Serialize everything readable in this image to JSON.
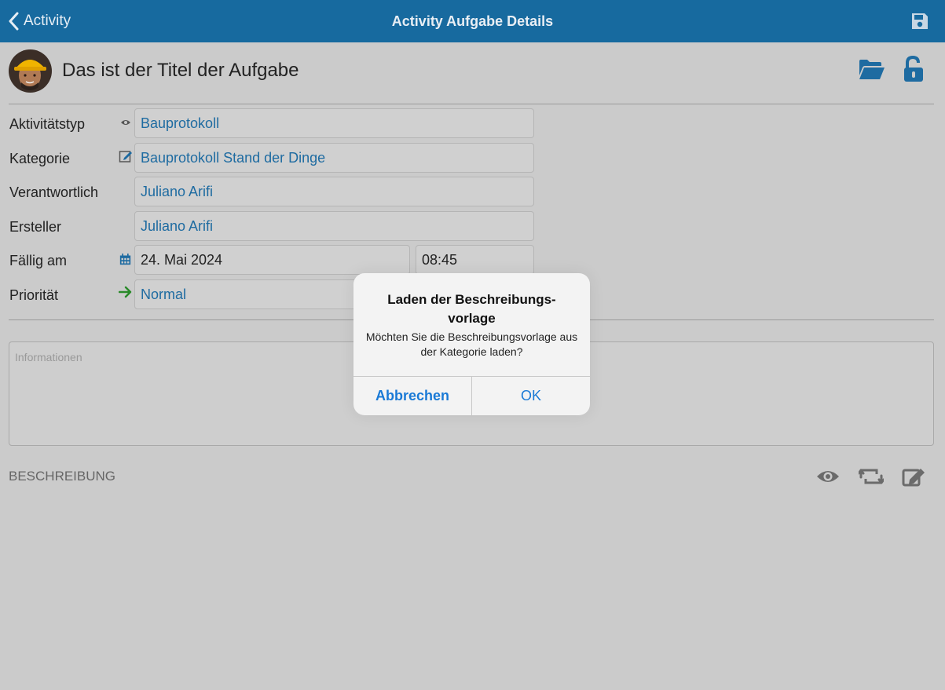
{
  "navbar": {
    "back_label": "Activity",
    "title": "Activity Aufgabe Details",
    "save_icon": "save-icon"
  },
  "header": {
    "task_title": "Das ist der Titel der Aufgabe",
    "folder_icon": "folder-open-icon",
    "lock_icon": "unlock-icon"
  },
  "form": {
    "aktivitaetstyp": {
      "label": "Aktivitätstyp",
      "value": "Bauprotokoll",
      "icon": "eye-icon"
    },
    "kategorie": {
      "label": "Kategorie",
      "value": "Bauprotokoll Stand der Dinge",
      "icon": "edit-icon"
    },
    "verantwortlich": {
      "label": "Verantwortlich",
      "value": "Juliano Arifi"
    },
    "ersteller": {
      "label": "Ersteller",
      "value": "Juliano Arifi"
    },
    "faellig": {
      "label": "Fällig am",
      "date": "24. Mai 2024",
      "time": "08:45",
      "icon": "calendar-icon"
    },
    "prioritaet": {
      "label": "Priorität",
      "value": "Normal",
      "icon": "arrow-right-icon"
    }
  },
  "info": {
    "placeholder": "Informationen"
  },
  "beschreibung": {
    "label": "BESCHREIBUNG"
  },
  "dialog": {
    "title": "Laden der Beschreibungs-vorlage",
    "message": "Möchten Sie die Beschreibungsvorlage aus der Kategorie laden?",
    "cancel_label": "Abbrechen",
    "ok_label": "OK"
  },
  "colors": {
    "navbar": "#176a9f",
    "accent": "#1e6ba1",
    "dialog_button": "#1a7ad6",
    "priority_arrow": "#2a8a2a"
  }
}
